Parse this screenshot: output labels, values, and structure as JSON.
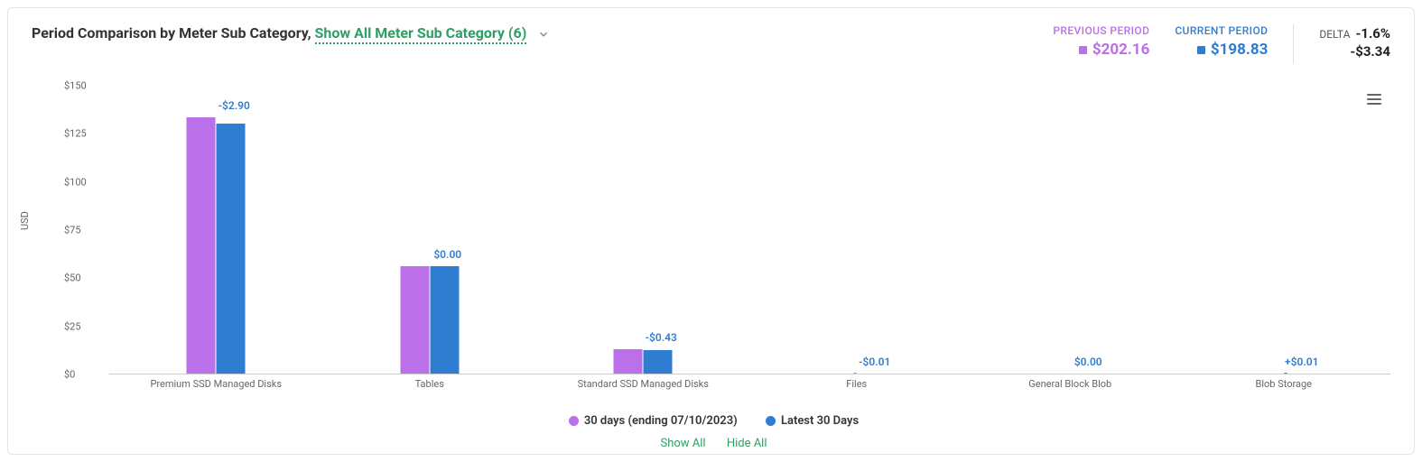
{
  "title_prefix": "Period Comparison by Meter Sub Category, ",
  "title_link": "Show All Meter Sub Category (6)",
  "summary": {
    "previous_label": "PREVIOUS PERIOD",
    "previous_value": "$202.16",
    "current_label": "CURRENT PERIOD",
    "current_value": "$198.83",
    "delta_label": "DELTA",
    "delta_pct": "-1.6%",
    "delta_amount": "-$3.34"
  },
  "y_axis_label": "USD",
  "y_ticks": [
    "$0",
    "$25",
    "$50",
    "$75",
    "$100",
    "$125",
    "$150"
  ],
  "legend": {
    "series1": "30 days (ending 07/10/2023)",
    "series2": "Latest 30 Days",
    "show_all": "Show All",
    "hide_all": "Hide All"
  },
  "chart_data": {
    "type": "bar",
    "ylabel": "USD",
    "ylim": [
      0,
      150
    ],
    "categories": [
      "Premium SSD Managed Disks",
      "Tables",
      "Standard SSD Managed Disks",
      "Files",
      "General Block Blob",
      "Blob Storage"
    ],
    "delta_labels": [
      "-$2.90",
      "$0.00",
      "-$0.43",
      "-$0.01",
      "$0.00",
      "+$0.01"
    ],
    "series": [
      {
        "name": "30 days (ending 07/10/2023)",
        "color": "#bb6fe8",
        "values": [
          132.9,
          56.0,
          12.43,
          0.01,
          0.0,
          0.0
        ]
      },
      {
        "name": "Latest 30 Days",
        "color": "#2f7dd1",
        "values": [
          130.0,
          56.0,
          12.0,
          0.0,
          0.0,
          0.01
        ]
      }
    ]
  }
}
